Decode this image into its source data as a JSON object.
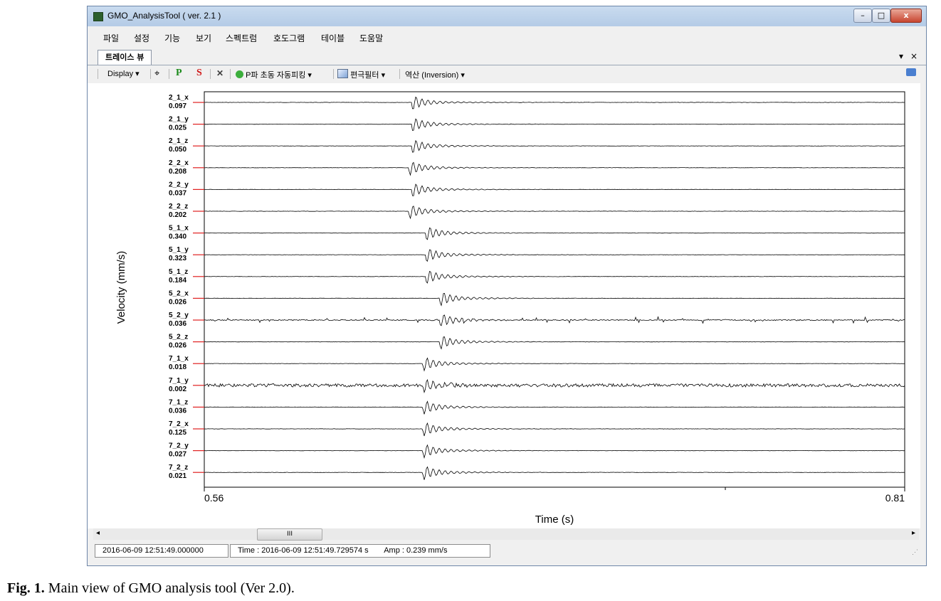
{
  "window": {
    "title": "GMO_AnalysisTool ( ver. 2.1 )",
    "minimize": "–",
    "maximize": "□",
    "close": "x"
  },
  "menu": [
    "파일",
    "설정",
    "기능",
    "보기",
    "스펙트럼",
    "호도그램",
    "테이블",
    "도움말"
  ],
  "tab": {
    "label": "트레이스 뷰",
    "dropdown": "▾",
    "close": "×"
  },
  "toolbar": {
    "display": "Display",
    "p_button": "P",
    "s_button": "S",
    "delete_button": "✕",
    "auto_pick": "P파 초동 자동피킹",
    "filter": "편극필터",
    "inversion": "역산 (Inversion)"
  },
  "chart_data": {
    "type": "line",
    "ylabel": "Velocity (mm/s)",
    "xlabel": "Time (s)",
    "xlim": [
      0.56,
      0.81
    ],
    "xticks": [
      "0.56",
      "0.81"
    ],
    "traces": [
      {
        "name": "2_1_x",
        "amp": "0.097",
        "style": "quiet",
        "onset": 0.634
      },
      {
        "name": "2_1_y",
        "amp": "0.025",
        "style": "quiet",
        "onset": 0.634
      },
      {
        "name": "2_1_z",
        "amp": "0.050",
        "style": "quiet",
        "onset": 0.634
      },
      {
        "name": "2_2_x",
        "amp": "0.208",
        "style": "quiet",
        "onset": 0.633
      },
      {
        "name": "2_2_y",
        "amp": "0.037",
        "style": "quiet",
        "onset": 0.634
      },
      {
        "name": "2_2_z",
        "amp": "0.202",
        "style": "quiet",
        "onset": 0.633
      },
      {
        "name": "5_1_x",
        "amp": "0.340",
        "style": "quiet",
        "onset": 0.639
      },
      {
        "name": "5_1_y",
        "amp": "0.323",
        "style": "quiet",
        "onset": 0.639
      },
      {
        "name": "5_1_z",
        "amp": "0.184",
        "style": "quiet",
        "onset": 0.639
      },
      {
        "name": "5_2_x",
        "amp": "0.026",
        "style": "quiet",
        "onset": 0.644
      },
      {
        "name": "5_2_y",
        "amp": "0.036",
        "style": "spiky",
        "onset": 0.644
      },
      {
        "name": "5_2_z",
        "amp": "0.026",
        "style": "quiet",
        "onset": 0.644
      },
      {
        "name": "7_1_x",
        "amp": "0.018",
        "style": "quiet",
        "onset": 0.638
      },
      {
        "name": "7_1_y",
        "amp": "0.002",
        "style": "noisy",
        "onset": 0.638
      },
      {
        "name": "7_1_z",
        "amp": "0.036",
        "style": "quiet",
        "onset": 0.638
      },
      {
        "name": "7_2_x",
        "amp": "0.125",
        "style": "quiet",
        "onset": 0.638
      },
      {
        "name": "7_2_y",
        "amp": "0.027",
        "style": "quiet",
        "onset": 0.638
      },
      {
        "name": "7_2_z",
        "amp": "0.021",
        "style": "quiet",
        "onset": 0.638
      }
    ]
  },
  "scrollbar": {
    "left_arrow": "◂",
    "right_arrow": "▸",
    "grip": "III"
  },
  "status": {
    "start_time": "2016-06-09 12:51:49.000000",
    "cursor_time": "Time : 2016-06-09 12:51:49.729574 s",
    "amp": "Amp : 0.239 mm/s"
  },
  "caption": {
    "label": "Fig. 1.",
    "text": " Main view of GMO analysis tool (Ver 2.0)."
  }
}
